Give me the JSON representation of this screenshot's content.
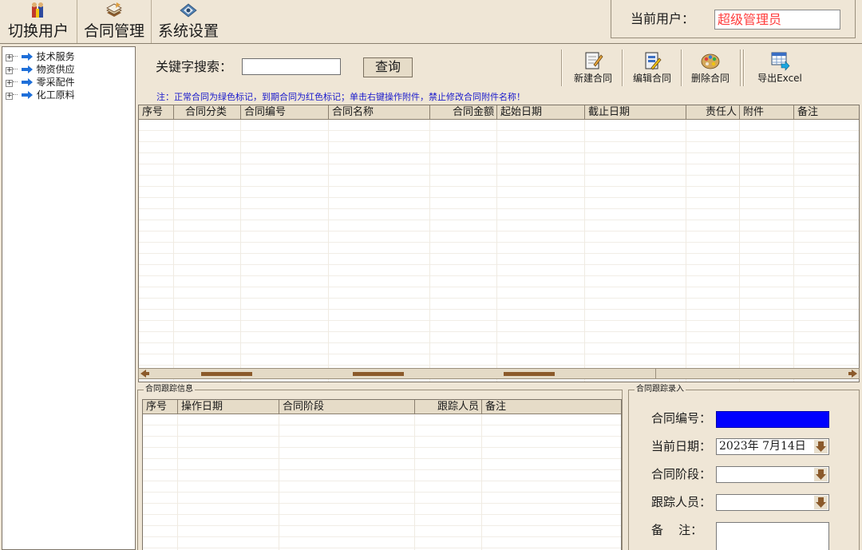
{
  "toolbar": {
    "switch_user": {
      "label": "切换用户",
      "icon": "users-icon"
    },
    "contract_mgmt": {
      "label": "合同管理",
      "icon": "document-stack-icon"
    },
    "system_settings": {
      "label": "系统设置",
      "icon": "settings-icon"
    }
  },
  "user": {
    "label": "当前用户：",
    "value": "超级管理员",
    "value_color": "#ff3c3c"
  },
  "tree": {
    "items": [
      {
        "label": "技术服务"
      },
      {
        "label": "物资供应"
      },
      {
        "label": "零采配件"
      },
      {
        "label": "化工原料"
      }
    ]
  },
  "search": {
    "label": "关键字搜索：",
    "value": "",
    "button": "查询"
  },
  "actions": {
    "new": {
      "label": "新建合同",
      "icon": "new-contract-icon"
    },
    "edit": {
      "label": "编辑合同",
      "icon": "edit-contract-icon"
    },
    "delete": {
      "label": "删除合同",
      "icon": "palette-icon"
    },
    "export": {
      "label": "导出Excel",
      "icon": "excel-export-icon"
    }
  },
  "note": "注：正常合同为绿色标记，到期合同为红色标记；单击右键操作附件，禁止修改合同附件名称！",
  "contract_table": {
    "columns": [
      "序号",
      "合同分类",
      "合同编号",
      "合同名称",
      "合同金额",
      "起始日期",
      "截止日期",
      "责任人",
      "附件",
      "备注"
    ]
  },
  "tracking_info": {
    "legend": "合同跟踪信息",
    "columns": [
      "序号",
      "操作日期",
      "合同阶段",
      "跟踪人员",
      "备注"
    ]
  },
  "tracking_entry": {
    "legend": "合同跟踪录入",
    "contract_no_label": "合同编号：",
    "contract_no_value": "",
    "contract_no_color": "#0000ff",
    "date_label": "当前日期：",
    "date_value": "2023年  7月14日",
    "stage_label": "合同阶段：",
    "stage_value": "",
    "person_label": "跟踪人员：",
    "person_value": "",
    "remark_label": "备    注：",
    "remark_value": ""
  }
}
